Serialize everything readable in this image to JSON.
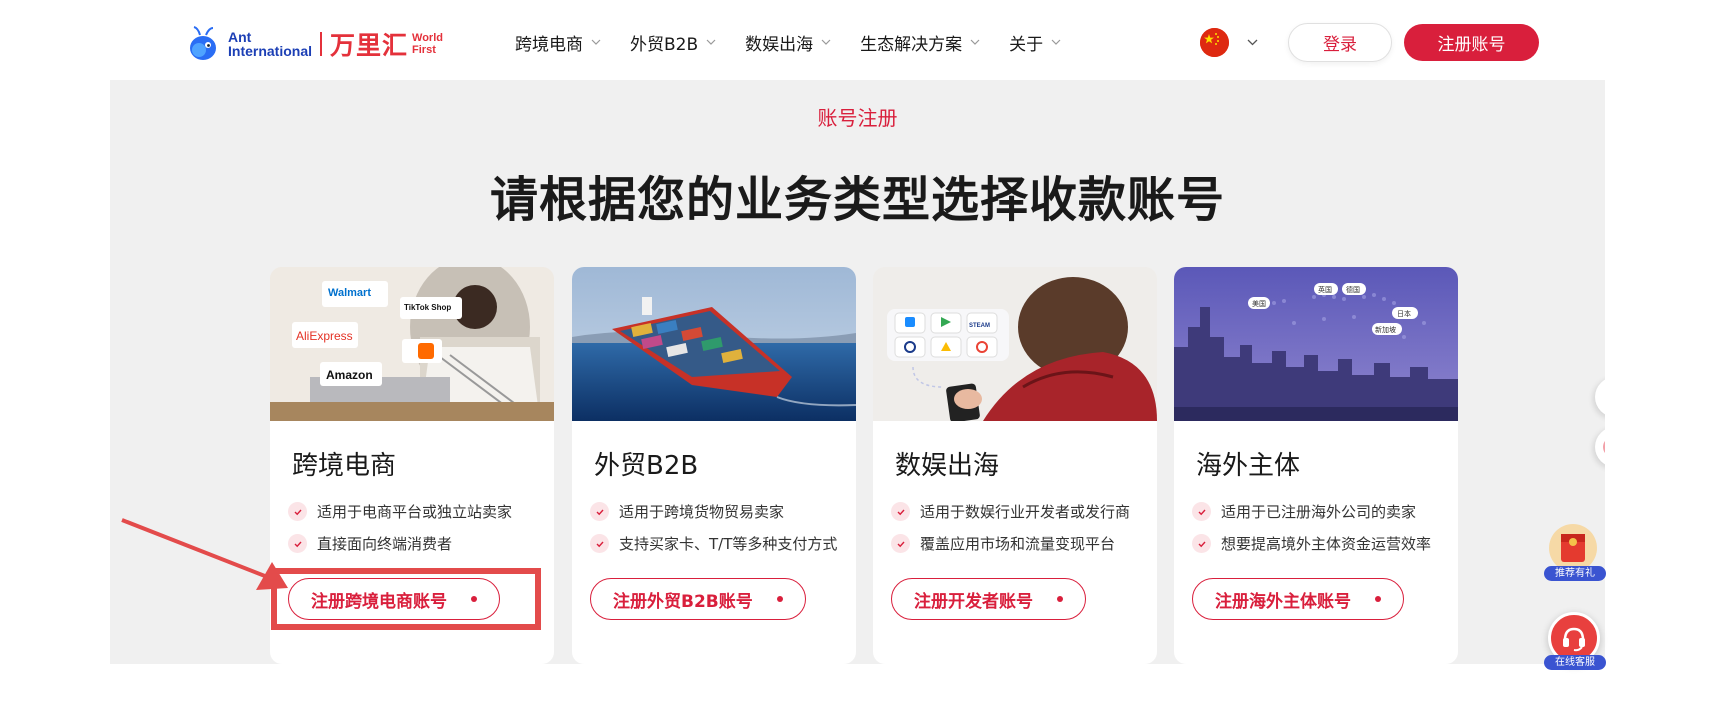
{
  "brand": {
    "logo_en_line1": "Ant",
    "logo_en_line2": "International",
    "logo_cn": "万里汇",
    "logo_wf_line1": "World",
    "logo_wf_line2": "First"
  },
  "nav": {
    "items": [
      {
        "label": "跨境电商"
      },
      {
        "label": "外贸B2B"
      },
      {
        "label": "数娱出海"
      },
      {
        "label": "生态解决方案"
      },
      {
        "label": "关于"
      }
    ]
  },
  "header_actions": {
    "login_label": "登录",
    "register_label": "注册账号"
  },
  "section": {
    "eyebrow": "账号注册",
    "headline": "请根据您的业务类型选择收款账号"
  },
  "cards": [
    {
      "title": "跨境电商",
      "features": [
        "适用于电商平台或独立站卖家",
        "直接面向终端消费者"
      ],
      "button": "注册跨境电商账号",
      "image_labels": [
        "Walmart",
        "TikTok Shop",
        "AliExpress",
        "Amazon"
      ]
    },
    {
      "title": "外贸B2B",
      "features": [
        "适用于跨境货物贸易卖家",
        "支持买家卡、T/T等多种支付方式"
      ],
      "button": "注册外贸B2B账号"
    },
    {
      "title": "数娱出海",
      "features": [
        "适用于数娱行业开发者或发行商",
        "覆盖应用市场和流量变现平台"
      ],
      "button": "注册开发者账号",
      "image_labels": [
        "STEAM"
      ]
    },
    {
      "title": "海外主体",
      "features": [
        "适用于已注册海外公司的卖家",
        "想要提高境外主体资金运营效率"
      ],
      "button": "注册海外主体账号",
      "image_labels": [
        "英国",
        "德国",
        "美国",
        "日本",
        "新加坡"
      ]
    }
  ],
  "floating": {
    "promo_label": "推荐有礼",
    "service_label": "在线客服"
  },
  "colors": {
    "accent": "#d91f3c",
    "brand_blue": "#1c3fb5",
    "band_bg": "#f0f0f0",
    "highlight": "#e34b4b"
  }
}
